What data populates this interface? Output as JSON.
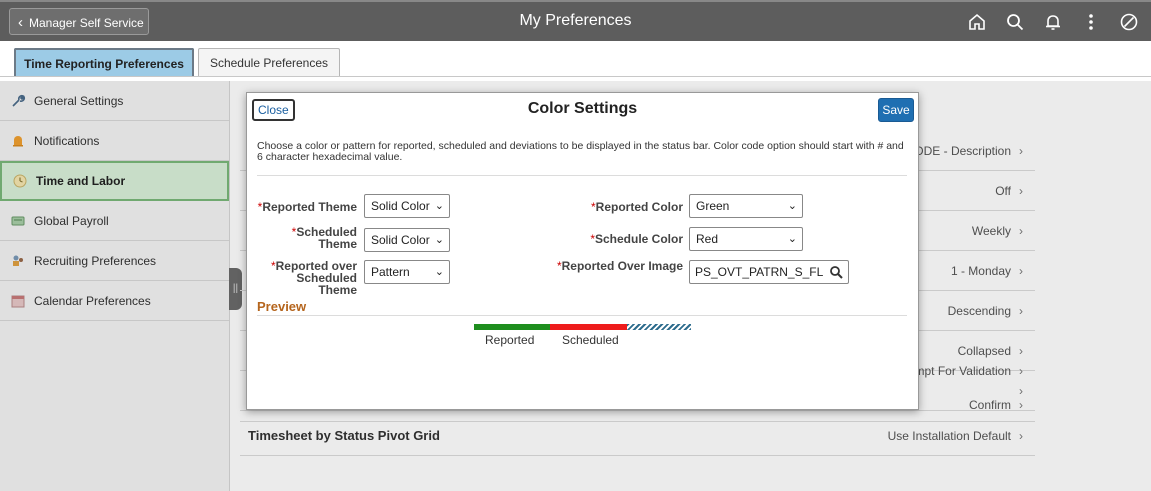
{
  "header": {
    "back_label": "Manager Self Service",
    "title": "My Preferences",
    "icons": [
      "home-icon",
      "search-icon",
      "notifications-icon",
      "actions-menu-icon",
      "navbar-icon"
    ]
  },
  "tabs": [
    {
      "label": "Time Reporting Preferences",
      "active": true
    },
    {
      "label": "Schedule Preferences",
      "active": false
    }
  ],
  "sidebar": {
    "items": [
      {
        "label": "General Settings",
        "icon": "wrench-icon"
      },
      {
        "label": "Notifications",
        "icon": "bell-icon"
      },
      {
        "label": "Time and Labor",
        "icon": "clock-icon",
        "active": true
      },
      {
        "label": "Global Payroll",
        "icon": "payroll-icon"
      },
      {
        "label": "Recruiting Preferences",
        "icon": "recruiting-icon"
      },
      {
        "label": "Calendar Preferences",
        "icon": "calendar-icon"
      }
    ]
  },
  "content": {
    "rows": [
      {
        "value": "ODE - Description"
      },
      {
        "value": "Off"
      },
      {
        "value": "Weekly"
      },
      {
        "value": "1 - Monday"
      },
      {
        "value": "Descending"
      },
      {
        "value": "Collapsed"
      },
      {
        "value": ""
      },
      {
        "value": "mpt For Validation"
      },
      {
        "value": "Confirm"
      },
      {
        "label": "Timesheet by Status Pivot Grid",
        "value": "Use Installation Default"
      }
    ]
  },
  "modal": {
    "close_label": "Close",
    "title": "Color Settings",
    "save_label": "Save",
    "description": "Choose a color or pattern for reported, scheduled and deviations to be displayed in the status bar. Color code option should start with # and 6 character hexadecimal value.",
    "required_mark": "*",
    "fields": {
      "reported_theme": {
        "label": "Reported Theme",
        "value": "Solid Color"
      },
      "scheduled_theme": {
        "label": "Scheduled Theme",
        "value": "Solid Color"
      },
      "reported_over_scheduled_theme": {
        "label": "Reported over Scheduled Theme",
        "value": "Pattern"
      },
      "reported_color": {
        "label": "Reported Color",
        "value": "Green"
      },
      "schedule_color": {
        "label": "Schedule Color",
        "value": "Red"
      },
      "reported_over_image": {
        "label": "Reported Over Image",
        "value": "PS_OVT_PATRN_S_FL"
      }
    },
    "preview": {
      "title": "Preview",
      "legend_reported": "Reported",
      "legend_scheduled": "Scheduled",
      "colors": {
        "reported": "#1e8e1e",
        "scheduled": "#ee1c1c",
        "pattern": "#2f6d8e"
      }
    }
  },
  "colors": {
    "banner": "#5d5d5d",
    "active_tab": "#9ccbe6",
    "active_sidebar": "#d9f0d9",
    "save_button": "#1f6fb2",
    "preview_heading": "#b5651d"
  }
}
